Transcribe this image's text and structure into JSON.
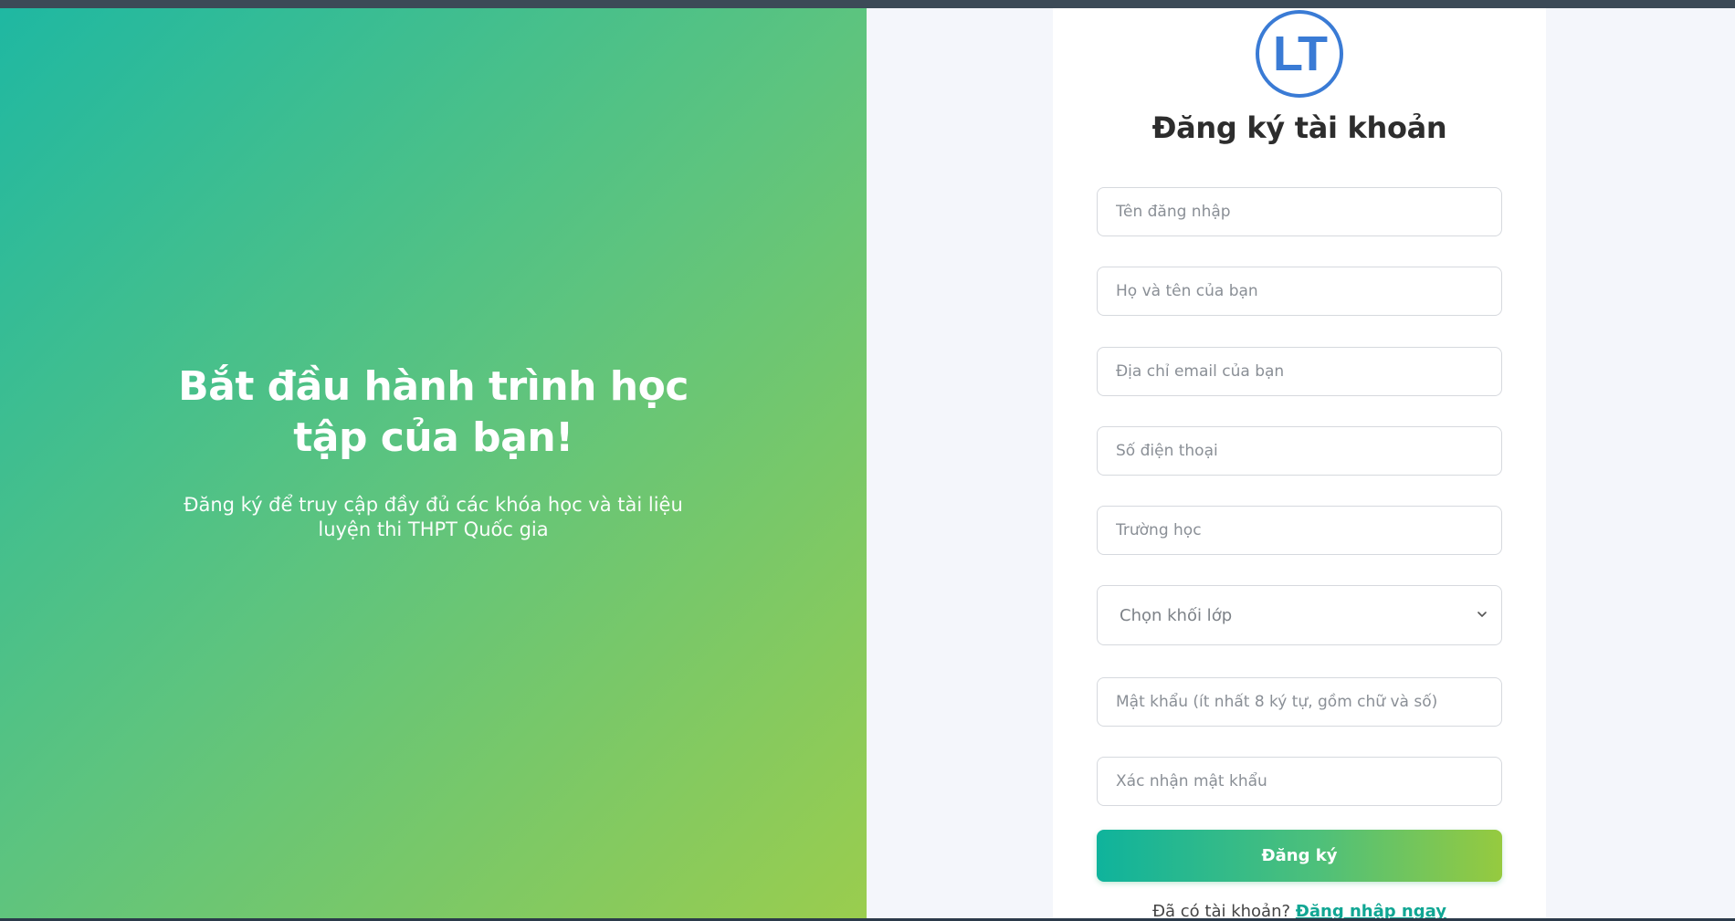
{
  "hero": {
    "title": "Bắt đầu hành trình học tập của bạn!",
    "subtitle": "Đăng ký để truy cập đầy đủ các khóa học và tài liệu luyện thi THPT Quốc gia"
  },
  "form": {
    "logo_text": "LT",
    "title": "Đăng ký tài khoản",
    "fields": {
      "username": {
        "placeholder": "Tên đăng nhập",
        "value": ""
      },
      "fullname": {
        "placeholder": "Họ và tên của bạn",
        "value": ""
      },
      "email": {
        "placeholder": "Địa chỉ email của bạn",
        "value": ""
      },
      "phone": {
        "placeholder": "Số điện thoại",
        "value": ""
      },
      "school": {
        "placeholder": "Trường học",
        "value": ""
      },
      "grade": {
        "selected": "Chọn khối lớp"
      },
      "password": {
        "placeholder": "Mật khẩu (ít nhất 8 ký tự, gồm chữ và số)",
        "value": ""
      },
      "confirm_password": {
        "placeholder": "Xác nhận mật khẩu",
        "value": ""
      }
    },
    "submit_label": "Đăng ký",
    "login_prompt": "Đã có tài khoản?",
    "login_link": "Đăng nhập ngay"
  },
  "colors": {
    "logo": "#3a7bd5",
    "gradient_start": "#1fb8a2",
    "gradient_end": "#9acd4e",
    "link": "#10a693"
  }
}
